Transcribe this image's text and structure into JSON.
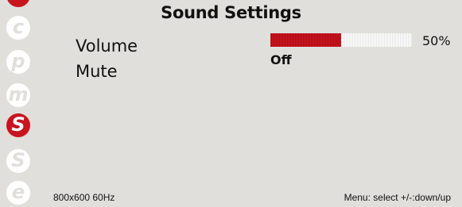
{
  "colors": {
    "background": "#e0dfdb",
    "accent": "#c8141f",
    "inactive_icon": "#ffffff"
  },
  "sidebar": {
    "items": [
      {
        "glyph": "",
        "icon": "partial-red-icon",
        "active": false
      },
      {
        "glyph": "c",
        "icon": "letter-c-icon",
        "active": false
      },
      {
        "glyph": "p",
        "icon": "letter-p-icon",
        "active": false
      },
      {
        "glyph": "m",
        "icon": "letter-m-icon",
        "active": false
      },
      {
        "glyph": "S",
        "icon": "letter-s-icon",
        "active": true
      },
      {
        "glyph": "S",
        "icon": "letter-s-icon",
        "active": false
      },
      {
        "glyph": "e",
        "icon": "letter-e-icon",
        "active": false
      }
    ]
  },
  "header": {
    "title": "Sound Settings"
  },
  "settings": {
    "volume": {
      "label": "Volume",
      "level": 0.5,
      "display": "50%"
    },
    "mute": {
      "label": "Mute",
      "value": "Off"
    }
  },
  "footer": {
    "resolution": "800x600 60Hz",
    "help": "Menu: select +/-:down/up"
  }
}
